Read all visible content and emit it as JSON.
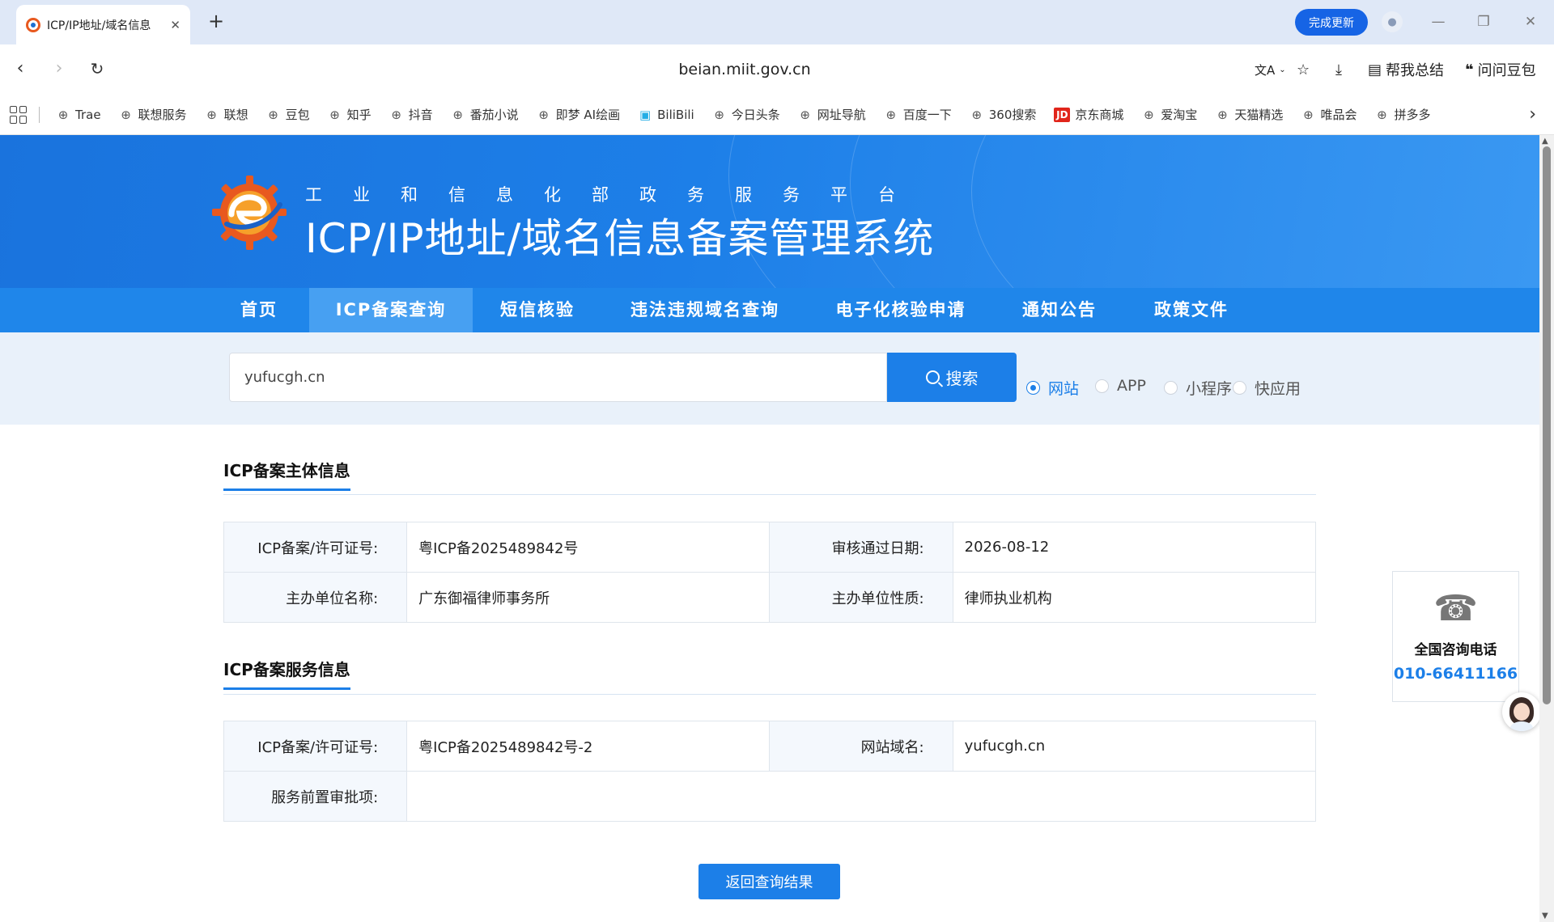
{
  "browser": {
    "tab_title": "ICP/IP地址/域名信息",
    "new_tab": "+",
    "update_button": "完成更新",
    "url": "beian.miit.gov.cn",
    "tools": {
      "translate": "文A",
      "summary": "帮我总结",
      "ask": "问问豆包"
    },
    "bookmarks": [
      {
        "label": "Trae",
        "icon": "globe-icon"
      },
      {
        "label": "联想服务",
        "icon": "globe-icon"
      },
      {
        "label": "联想",
        "icon": "globe-icon"
      },
      {
        "label": "豆包",
        "icon": "globe-icon"
      },
      {
        "label": "知乎",
        "icon": "globe-icon"
      },
      {
        "label": "抖音",
        "icon": "globe-icon"
      },
      {
        "label": "番茄小说",
        "icon": "globe-icon"
      },
      {
        "label": "即梦 AI绘画",
        "icon": "globe-icon"
      },
      {
        "label": "BiliBili",
        "icon": "bilibili-icon"
      },
      {
        "label": "今日头条",
        "icon": "globe-icon"
      },
      {
        "label": "网址导航",
        "icon": "globe-icon"
      },
      {
        "label": "百度一下",
        "icon": "globe-icon"
      },
      {
        "label": "360搜索",
        "icon": "globe-icon"
      },
      {
        "label": "京东商城",
        "icon": "jd-icon"
      },
      {
        "label": "爱淘宝",
        "icon": "globe-icon"
      },
      {
        "label": "天猫精选",
        "icon": "globe-icon"
      },
      {
        "label": "唯品会",
        "icon": "globe-icon"
      },
      {
        "label": "拼多多",
        "icon": "globe-icon"
      }
    ],
    "jd_badge": "JD"
  },
  "site": {
    "subtitle": "工业和信息化部政务服务平台",
    "title": "ICP/IP地址/域名信息备案管理系统",
    "nav": [
      {
        "label": "首页",
        "active": false
      },
      {
        "label": "ICP备案查询",
        "active": true
      },
      {
        "label": "短信核验",
        "active": false
      },
      {
        "label": "违法违规域名查询",
        "active": false
      },
      {
        "label": "电子化核验申请",
        "active": false
      },
      {
        "label": "通知公告",
        "active": false
      },
      {
        "label": "政策文件",
        "active": false
      }
    ],
    "search": {
      "value": "yufucgh.cn",
      "button": "搜索",
      "types": [
        {
          "label": "网站",
          "checked": true
        },
        {
          "label": "APP",
          "checked": false
        },
        {
          "label": "小程序",
          "checked": false
        },
        {
          "label": "快应用",
          "checked": false
        }
      ]
    }
  },
  "subject": {
    "heading": "ICP备案主体信息",
    "license_label": "ICP备案/许可证号:",
    "license_value": "粤ICP备2025489842号",
    "approve_label": "审核通过日期:",
    "approve_value": "2026-08-12",
    "org_label": "主办单位名称:",
    "org_value": "广东御福律师事务所",
    "nature_label": "主办单位性质:",
    "nature_value": "律师执业机构"
  },
  "service": {
    "heading": "ICP备案服务信息",
    "license_label": "ICP备案/许可证号:",
    "license_value": "粤ICP备2025489842号-2",
    "domain_label": "网站域名:",
    "domain_value": "yufucgh.cn",
    "approval_label": "服务前置审批项:",
    "approval_value": ""
  },
  "back_button": "返回查询结果",
  "hotline": {
    "title": "全国咨询电话",
    "number": "010-66411166"
  },
  "colors": {
    "primary": "#1c7fe8",
    "nav_bg": "#1f86ea",
    "nav_active": "#47a0f2",
    "search_band": "#e9f1fa",
    "update_button": "#1664e5"
  }
}
